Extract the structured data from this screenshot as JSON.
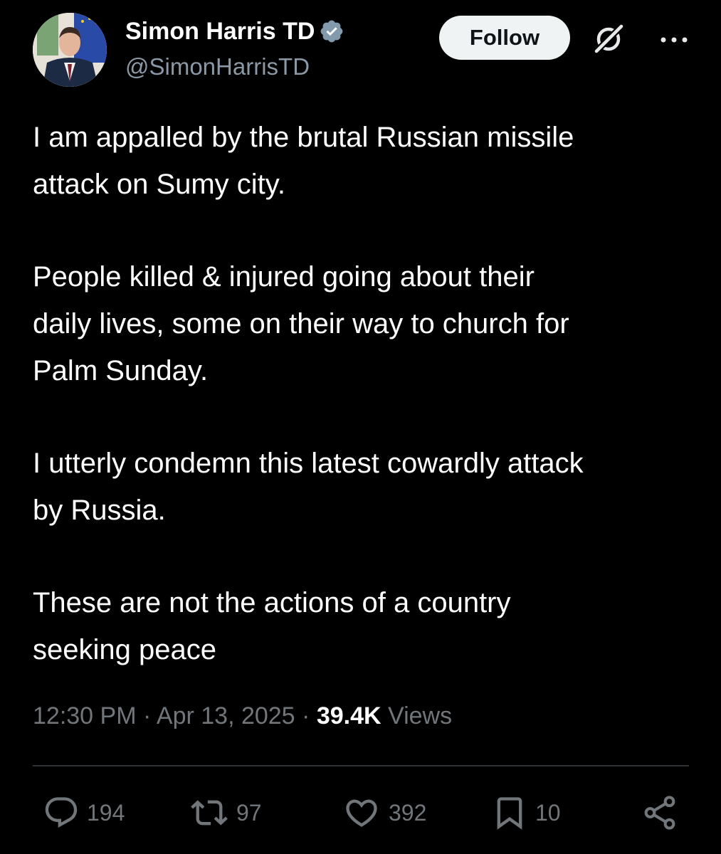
{
  "author": {
    "display_name": "Simon Harris TD",
    "handle": "@SimonHarrisTD",
    "verified": true
  },
  "header": {
    "follow_label": "Follow",
    "icons": [
      "grok-icon",
      "more-icon"
    ]
  },
  "tweet": {
    "paragraphs": [
      "I am appalled by the brutal Russian missile\nattack on Sumy city.",
      "People killed & injured going about their\ndaily lives, some on their way to church for\nPalm Sunday.",
      "I utterly condemn this latest cowardly attack\nby Russia.",
      "These are not the actions of a country\nseeking peace"
    ]
  },
  "meta": {
    "time": "12:30 PM",
    "separator": "·",
    "date": "Apr 13, 2025",
    "views_count": "39.4K",
    "views_label": "Views"
  },
  "actions": {
    "replies": "194",
    "reposts": "97",
    "likes": "392",
    "bookmarks": "10"
  },
  "colors": {
    "background": "#000000",
    "text_primary": "#ffffff",
    "text_secondary": "#71767b",
    "verified_badge": "#829aab",
    "follow_button_bg": "#eff3f4",
    "divider": "#2f3336"
  }
}
